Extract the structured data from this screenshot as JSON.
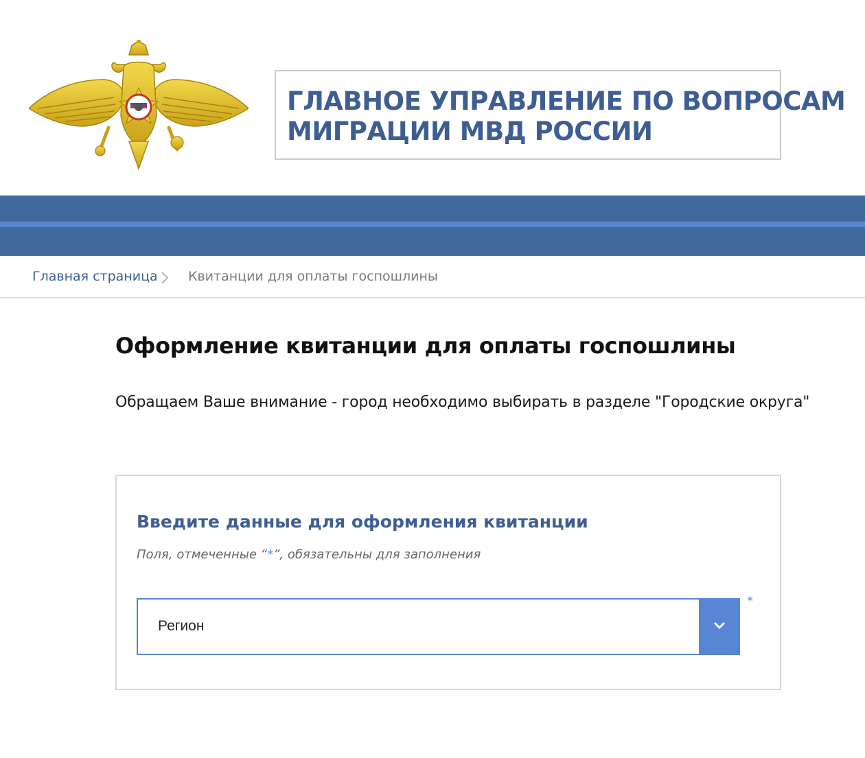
{
  "header": {
    "title_line1": "ГЛАВНОЕ УПРАВЛЕНИЕ ПО ВОПРОСАМ",
    "title_line2": "МИГРАЦИИ МВД РОССИИ",
    "emblem_icon": "double-headed-eagle-emblem-icon",
    "emblem_color": "#e2c12a",
    "title_color": "#3e5e93",
    "band_color": "#42699c",
    "band_line_color": "#5886d4"
  },
  "breadcrumb": {
    "home_label": "Главная страница",
    "separator_icon": "chevron-right-icon",
    "current_label": "Квитанции для оплаты госпошлины"
  },
  "main": {
    "page_title": "Оформление квитанции для оплаты госпошлины",
    "notice": "Обращаем Ваше внимание -  город необходимо выбирать в разделе \"Городские округа\""
  },
  "form": {
    "title": "Введите данные для оформления квитанции",
    "hint_before": "Поля, отмеченные “",
    "hint_star": "*",
    "hint_after": "”, обязательны для заполнения",
    "region_select": {
      "selected_value": "Регион",
      "toggle_icon": "chevron-down-icon",
      "required_mark": "*"
    },
    "accent_color": "#5886d4"
  }
}
